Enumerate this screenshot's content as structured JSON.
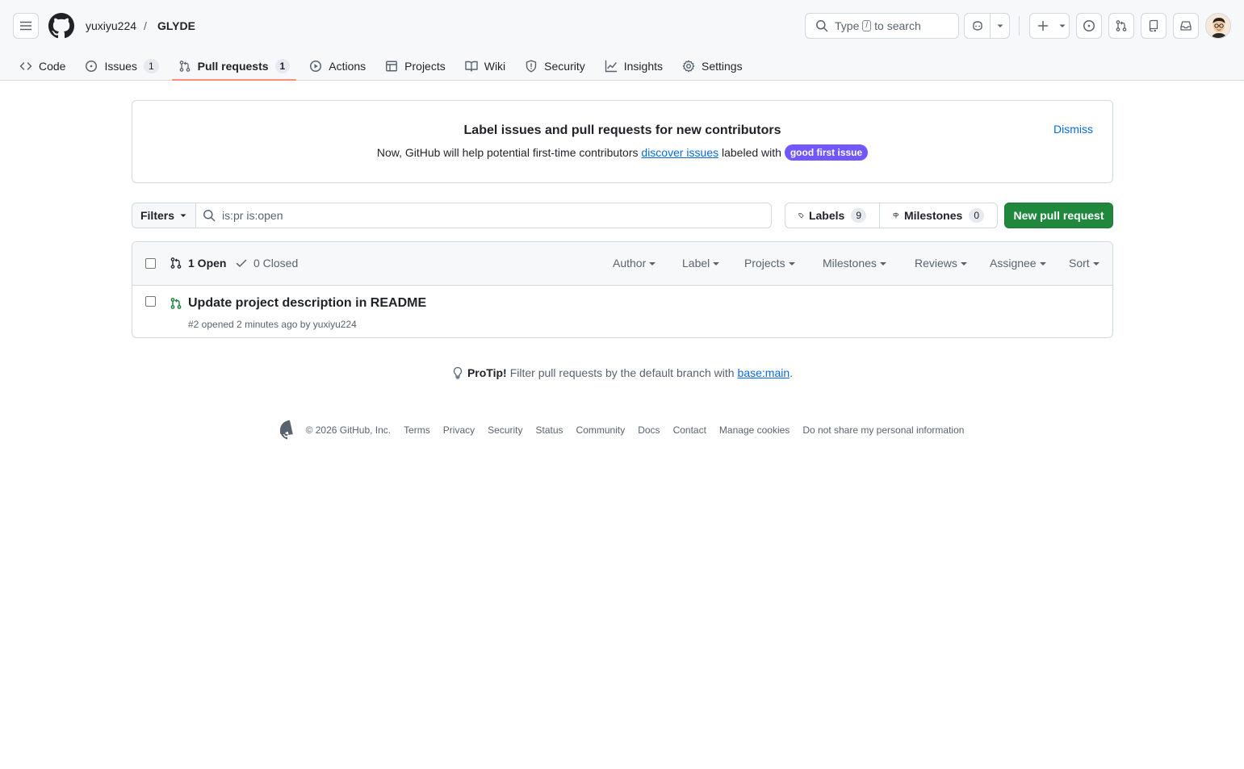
{
  "breadcrumb": {
    "owner": "yuxiyu224",
    "separator": "/",
    "repo": "GLYDE"
  },
  "search": {
    "prefix": "Type",
    "key": "/",
    "suffix": "to search"
  },
  "tabs": [
    {
      "label": "Code",
      "icon": "code-icon"
    },
    {
      "label": "Issues",
      "icon": "issue-opened-icon",
      "count": "1"
    },
    {
      "label": "Pull requests",
      "icon": "git-pull-request-icon",
      "count": "1",
      "active": true
    },
    {
      "label": "Actions",
      "icon": "play-icon"
    },
    {
      "label": "Projects",
      "icon": "table-icon"
    },
    {
      "label": "Wiki",
      "icon": "book-icon"
    },
    {
      "label": "Security",
      "icon": "shield-icon"
    },
    {
      "label": "Insights",
      "icon": "graph-icon"
    },
    {
      "label": "Settings",
      "icon": "gear-icon"
    }
  ],
  "banner": {
    "title": "Label issues and pull requests for new contributors",
    "text_before": "Now, GitHub will help potential first-time contributors",
    "link": "discover issues",
    "text_after": "labeled with",
    "label_badge": "good first issue",
    "dismiss": "Dismiss"
  },
  "toolbar": {
    "filters": "Filters",
    "query": "is:pr is:open",
    "labels": "Labels",
    "labels_count": "9",
    "milestones": "Milestones",
    "milestones_count": "0",
    "new_pr": "New pull request"
  },
  "list": {
    "open": "1 Open",
    "closed": "0 Closed",
    "filters": [
      "Author",
      "Label",
      "Projects",
      "Milestones",
      "Reviews",
      "Assignee",
      "Sort"
    ],
    "items": [
      {
        "title": "Update project description in README",
        "meta": "#2 opened 2 minutes ago by yuxiyu224"
      }
    ]
  },
  "protip": {
    "label": "ProTip!",
    "text": "Filter pull requests by the default branch with",
    "link": "base:main",
    "end": "."
  },
  "footer": {
    "copyright": "© 2026 GitHub, Inc.",
    "links": [
      "Terms",
      "Privacy",
      "Security",
      "Status",
      "Community",
      "Docs",
      "Contact",
      "Manage cookies",
      "Do not share my personal information"
    ]
  },
  "colors": {
    "accent_green": "#1f883d",
    "link_blue": "#0969da",
    "label_purple": "#7057ff",
    "tab_underline": "#fd8c73",
    "open_green": "#1a7f37"
  }
}
